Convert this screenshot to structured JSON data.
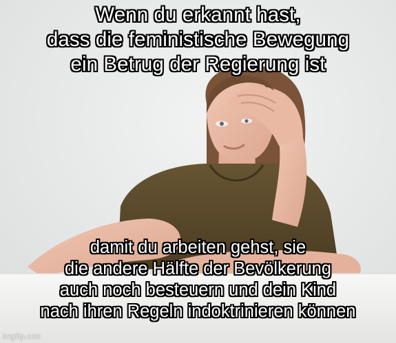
{
  "meme": {
    "top_caption": {
      "lines": [
        "Wenn du erkannt hast,",
        "dass die feministische Bewegung",
        "ein Betrug der Regierung ist"
      ]
    },
    "bottom_caption": {
      "lines": [
        "damit du arbeiten gehst, sie",
        "die andere Hälfte der Bevölkerung",
        "auch noch besteuern und dein Kind",
        "nach ihren Regeln indoktrinieren können"
      ]
    },
    "watermark": "imgflip.com"
  },
  "colors": {
    "caption_text": "#ffffff",
    "caption_outline": "#000000",
    "shirt": "#5b4a2c",
    "skin": "#e7b9a2",
    "hair": "#7a5338",
    "table": "#f3f3f2",
    "background": "#e9eaea"
  }
}
